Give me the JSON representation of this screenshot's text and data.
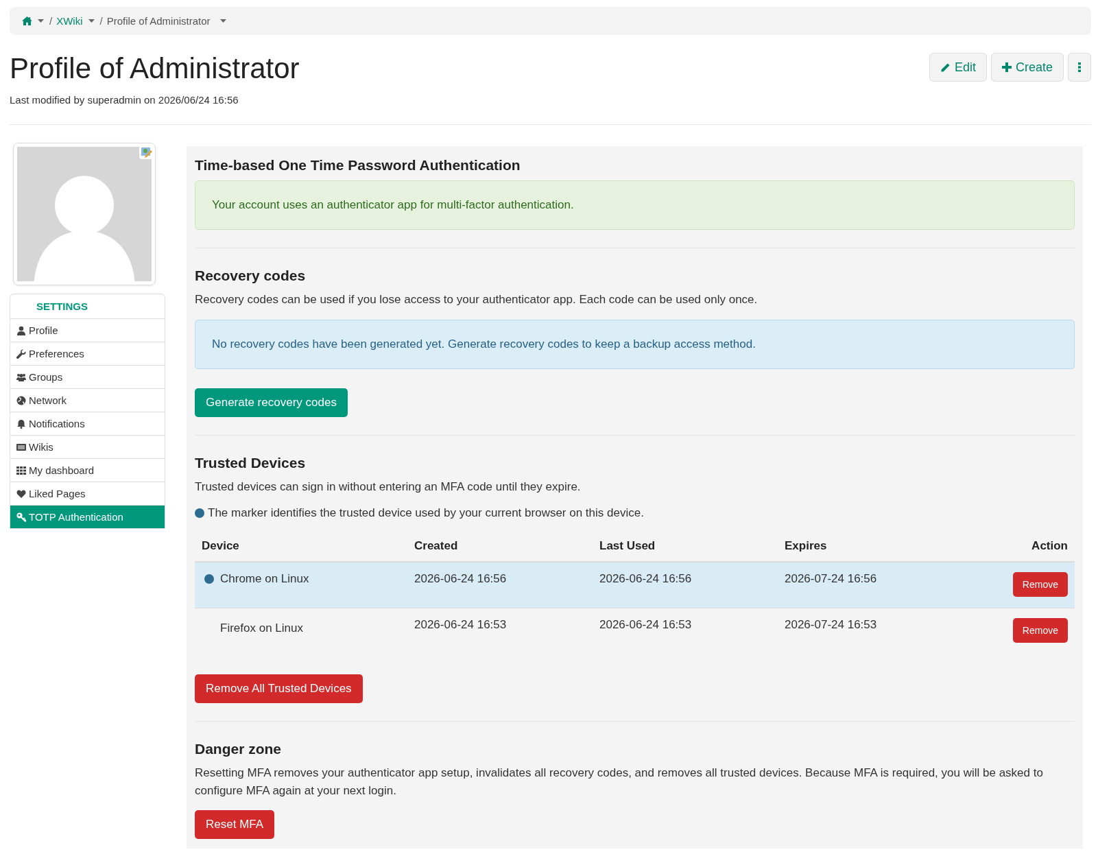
{
  "breadcrumb": [
    {
      "separator": "/",
      "label": "XWiki",
      "kind": "link"
    },
    {
      "separator": "/",
      "label": "Profile of Administrator",
      "kind": "current"
    }
  ],
  "title": "Profile of Administrator",
  "last_modified": "Last modified by superadmin on 2026/06/24 16:56",
  "actions": [
    {
      "label": "Edit",
      "kind": "edit"
    },
    {
      "label": "Create",
      "kind": "create"
    },
    {
      "kind": "more"
    }
  ],
  "sidebar": {
    "heading": "SETTINGS",
    "items": [
      {
        "label": "Profile",
        "selected": false
      },
      {
        "label": "Preferences",
        "selected": false
      },
      {
        "label": "Groups",
        "selected": false
      },
      {
        "label": "Network",
        "selected": false
      },
      {
        "label": "Notifications",
        "selected": false
      },
      {
        "label": "Wikis",
        "selected": false
      },
      {
        "label": "My dashboard",
        "selected": false
      },
      {
        "label": "Liked Pages",
        "selected": false
      },
      {
        "label": "TOTP Authentication",
        "selected": true
      }
    ]
  },
  "totp": {
    "heading": "Time-based One Time Password Authentication",
    "alert": {
      "kind": "success",
      "text": "Your account uses an authenticator app for multi-factor authentication."
    }
  },
  "recovery": {
    "heading": "Recovery codes",
    "description": "Recovery codes can be used if you lose access to your authenticator app. Each code can be used only once.",
    "alert": {
      "kind": "info",
      "text": "No recovery codes have been generated yet. Generate recovery codes to keep a backup access method."
    },
    "button": "Generate recovery codes"
  },
  "trusted": {
    "heading": "Trusted Devices",
    "description": "Trusted devices can sign in without entering an MFA code until they expire.",
    "marker_note": "The marker identifies the trusted device used by your current browser on this device.",
    "columns": [
      "Device",
      "Created",
      "Last Used",
      "Expires",
      "Action"
    ],
    "rows": [
      {
        "device": "Chrome on Linux",
        "created": "2026-06-24 16:56",
        "last_used": "2026-06-24 16:56",
        "expires": "2026-07-24 16:56",
        "action": "Remove",
        "current": true
      },
      {
        "device": "Firefox on Linux",
        "created": "2026-06-24 16:53",
        "last_used": "2026-06-24 16:53",
        "expires": "2026-07-24 16:53",
        "action": "Remove",
        "current": false
      }
    ],
    "remove_all": "Remove All Trusted Devices"
  },
  "danger": {
    "heading": "Danger zone",
    "description": "Resetting MFA removes your authenticator app setup, invalidates all recovery codes, and removes all trusted devices. Because MFA is required, you will be asked to configure MFA again at your next login.",
    "button": "Reset MFA"
  }
}
